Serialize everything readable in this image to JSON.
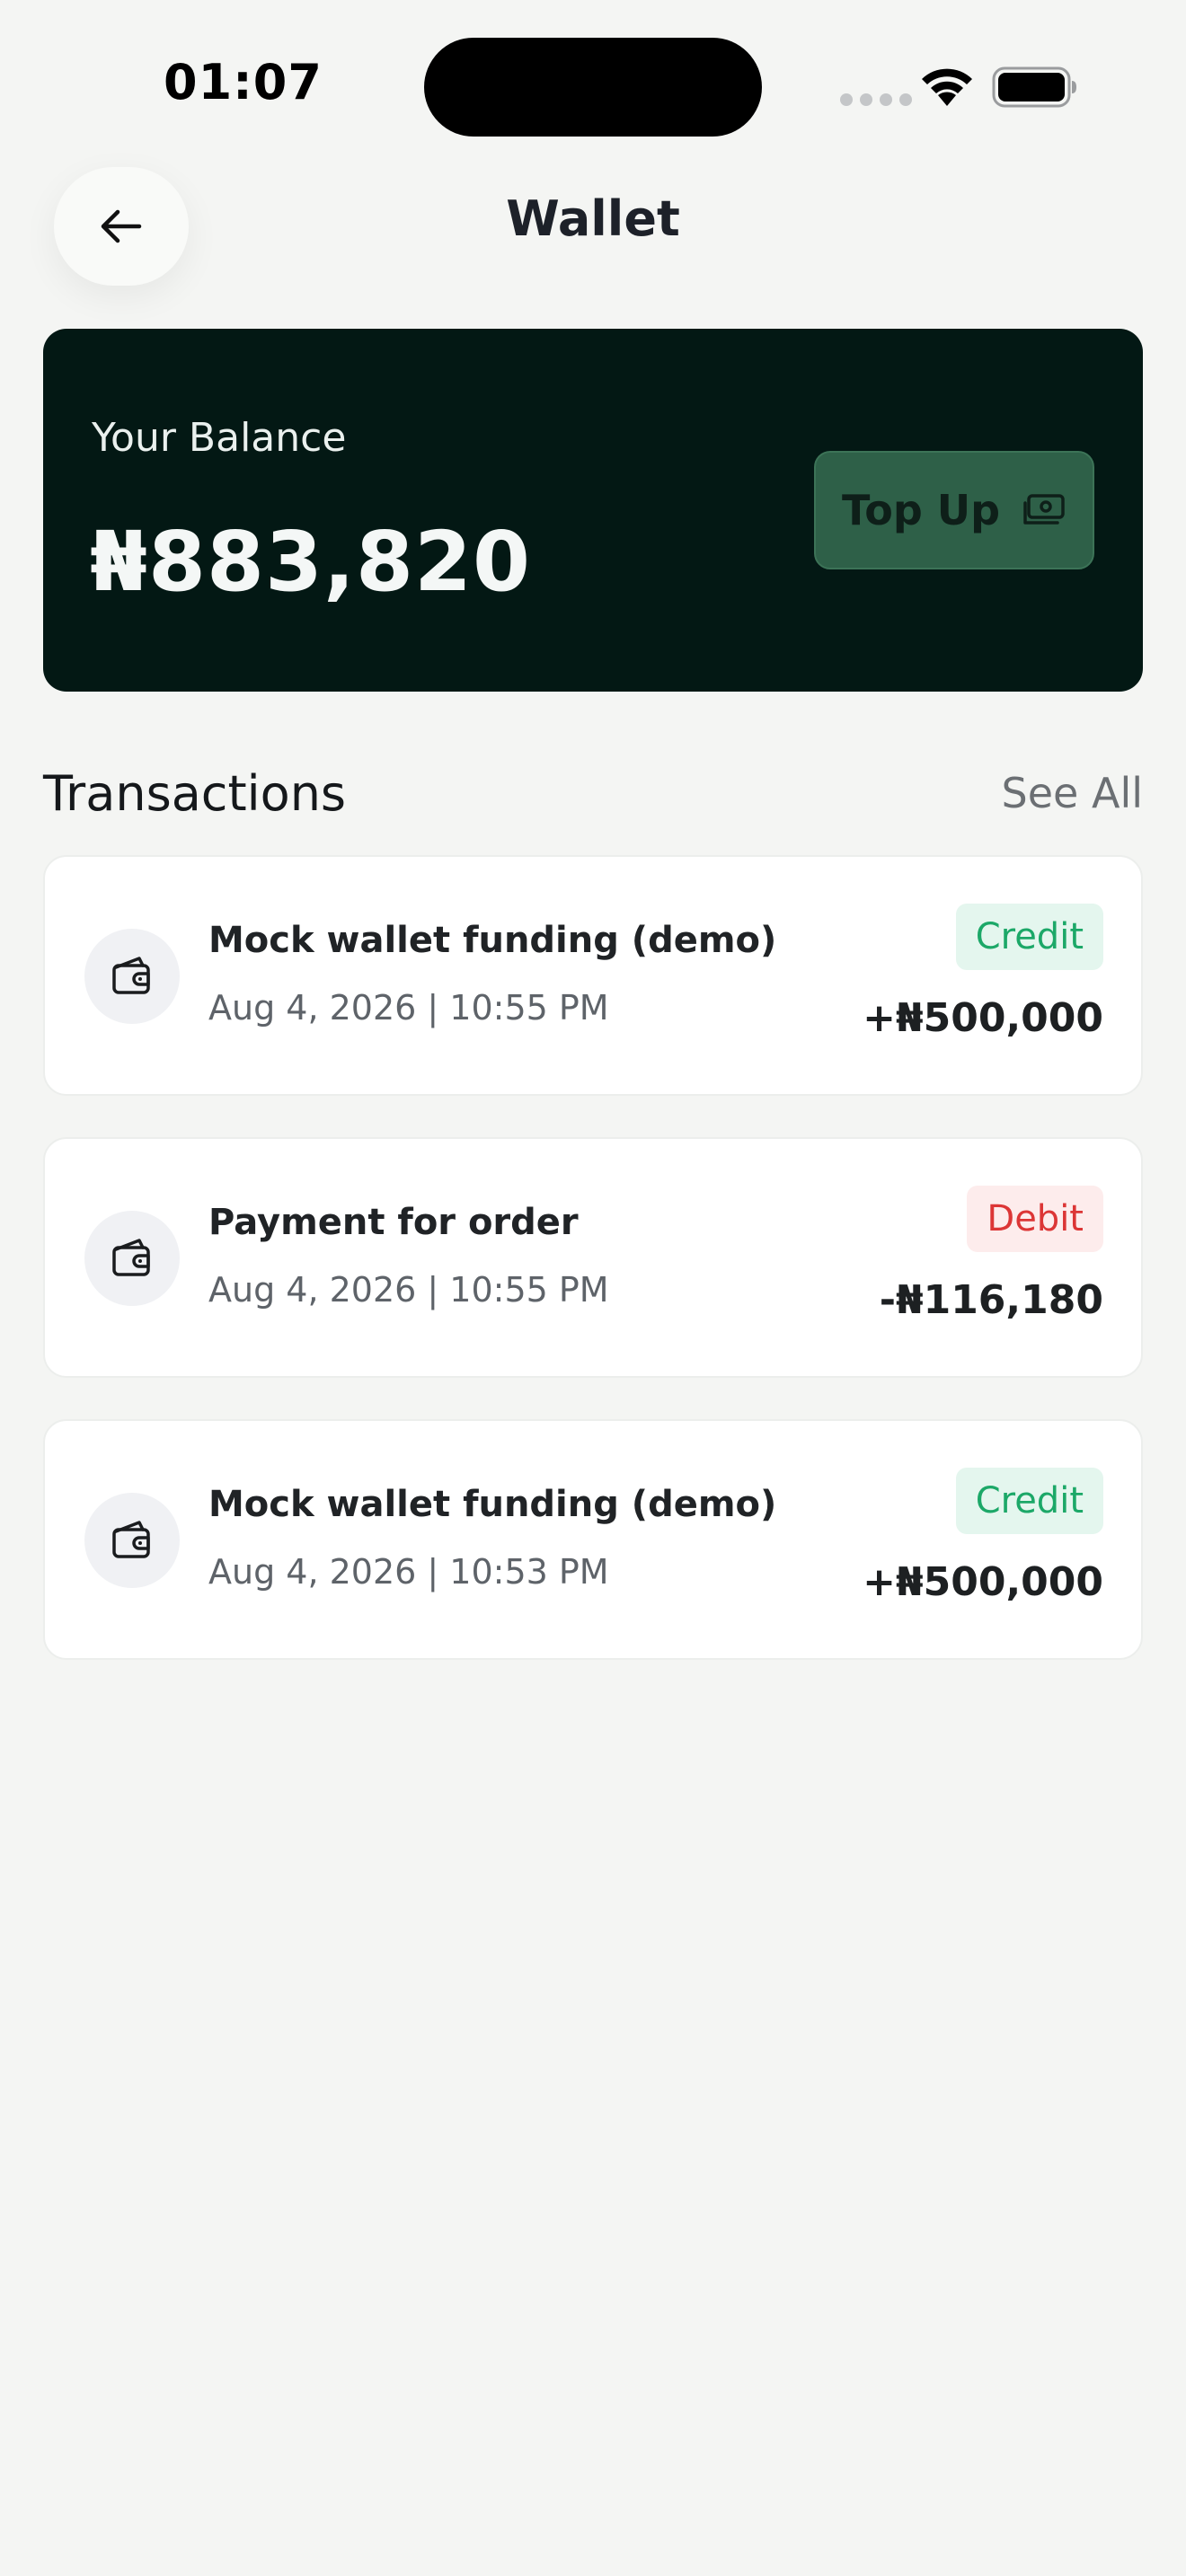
{
  "status_bar": {
    "time": "01:07"
  },
  "header": {
    "title": "Wallet",
    "back_icon": "arrow-left-icon"
  },
  "balance": {
    "label": "Your Balance",
    "amount": "₦883,820",
    "topup_label": "Top Up",
    "topup_icon": "cash-icon"
  },
  "transactions": {
    "heading": "Transactions",
    "see_all": "See All",
    "items": [
      {
        "title": "Mock wallet funding (demo)",
        "date": "Aug 4, 2026 | 10:55 PM",
        "type": "Credit",
        "amount": "+₦500,000",
        "icon": "wallet-icon"
      },
      {
        "title": "Payment for order",
        "date": "Aug 4, 2026 | 10:55 PM",
        "type": "Debit",
        "amount": "-₦116,180",
        "icon": "wallet-icon"
      },
      {
        "title": "Mock wallet funding (demo)",
        "date": "Aug 4, 2026 | 10:53 PM",
        "type": "Credit",
        "amount": "+₦500,000",
        "icon": "wallet-icon"
      }
    ]
  },
  "colors": {
    "background": "#f4f5f3",
    "card_dark": "#031814",
    "topup_bg": "#2e6048",
    "credit_text": "#1ca868",
    "credit_bg": "#e4f6ee",
    "debit_text": "#dc3636",
    "debit_bg": "#fdecec"
  }
}
